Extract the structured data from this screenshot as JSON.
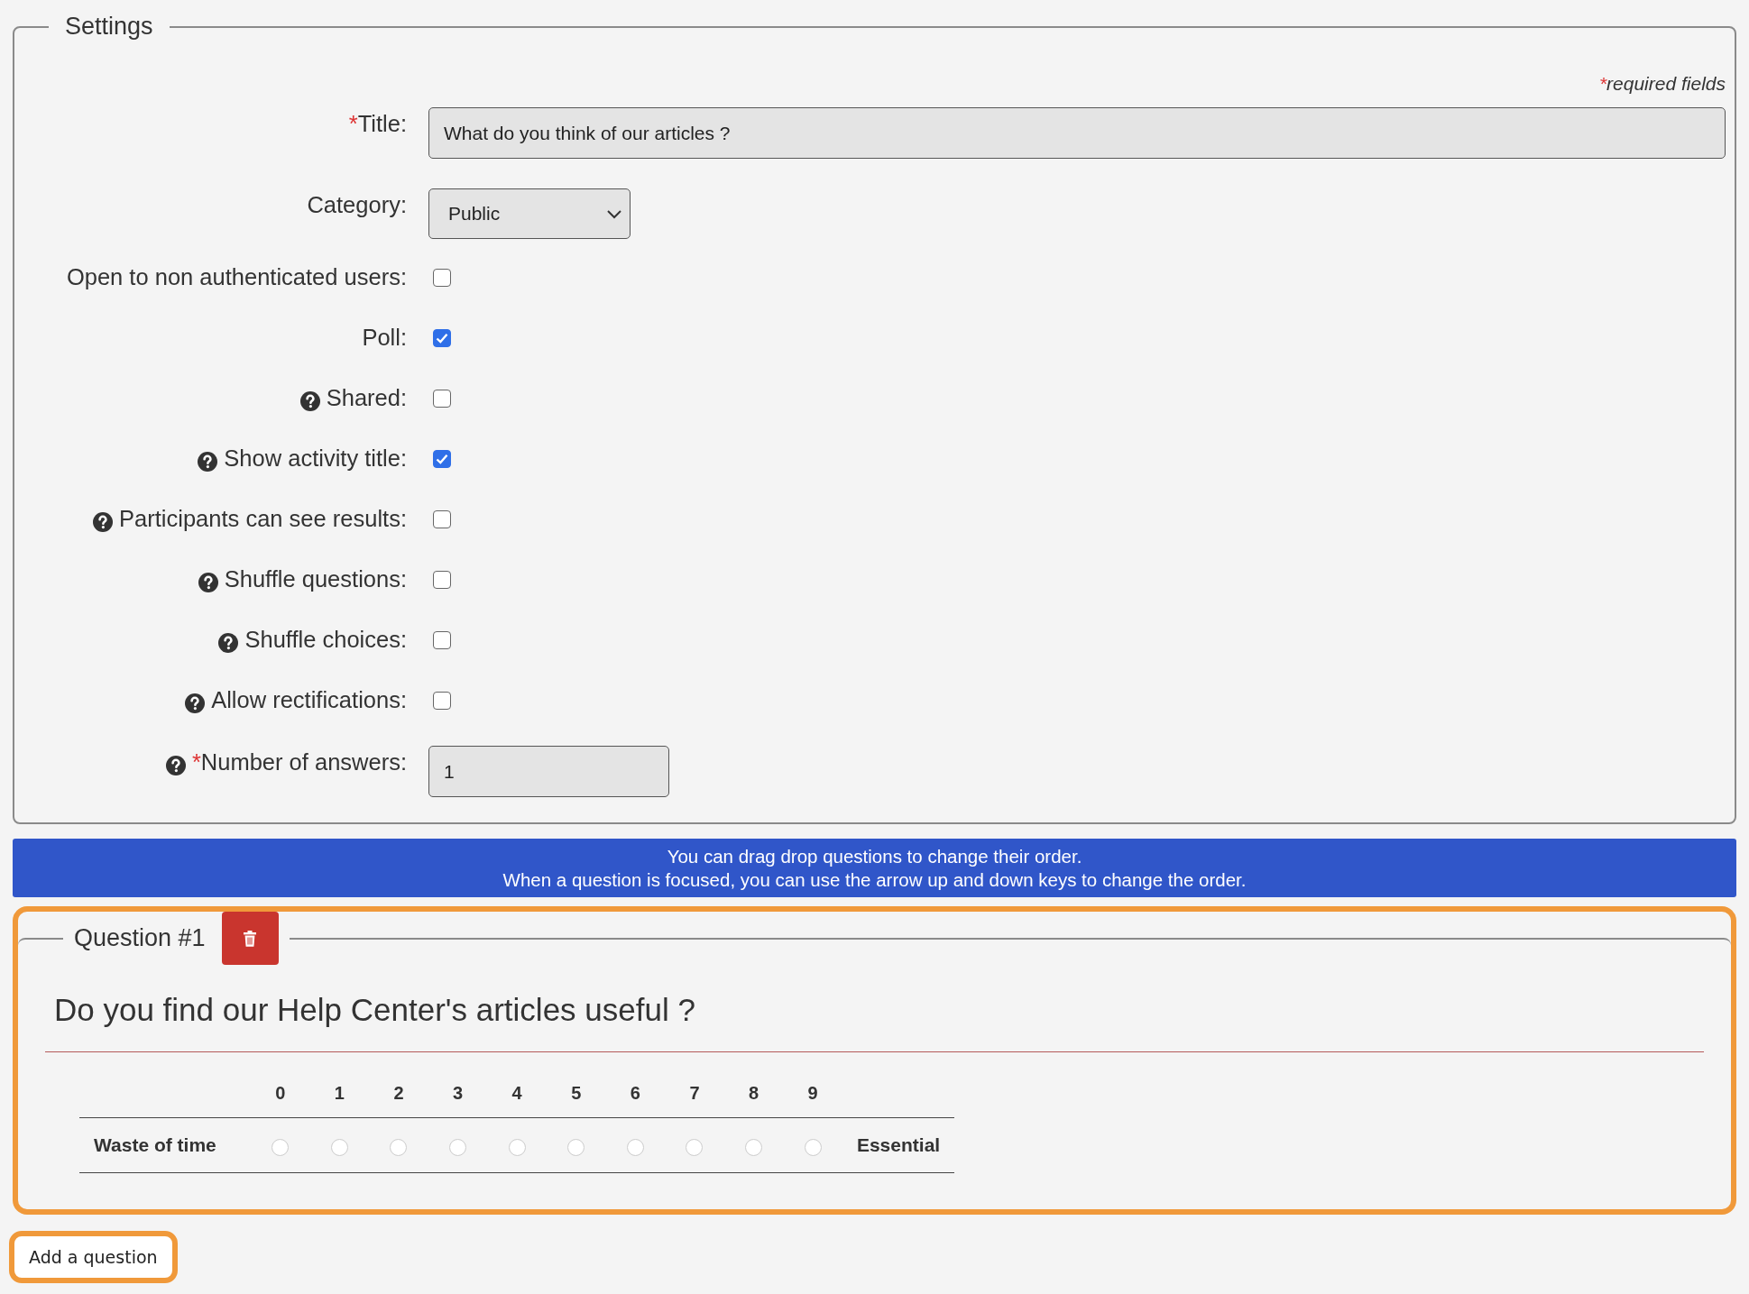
{
  "settings": {
    "legend": "Settings",
    "required_note": {
      "mark": "*",
      "text": "required fields"
    },
    "rows": [
      {
        "kind": "text",
        "label": "Title:",
        "required": true,
        "help": false,
        "value": "What do you think of our articles ?"
      },
      {
        "kind": "select",
        "label": "Category:",
        "required": false,
        "help": false,
        "value": "Public"
      },
      {
        "kind": "checkbox",
        "label": "Open to non authenticated users:",
        "required": false,
        "help": false,
        "checked": false
      },
      {
        "kind": "checkbox",
        "label": "Poll:",
        "required": false,
        "help": false,
        "checked": true
      },
      {
        "kind": "checkbox",
        "label": "Shared:",
        "required": false,
        "help": true,
        "checked": false
      },
      {
        "kind": "checkbox",
        "label": "Show activity title:",
        "required": false,
        "help": true,
        "checked": true
      },
      {
        "kind": "checkbox",
        "label": "Participants can see results:",
        "required": false,
        "help": true,
        "checked": false
      },
      {
        "kind": "checkbox",
        "label": "Shuffle questions:",
        "required": false,
        "help": true,
        "checked": false
      },
      {
        "kind": "checkbox",
        "label": "Shuffle choices:",
        "required": false,
        "help": true,
        "checked": false
      },
      {
        "kind": "checkbox",
        "label": "Allow rectifications:",
        "required": false,
        "help": true,
        "checked": false
      },
      {
        "kind": "number",
        "label": "Number of answers:",
        "required": true,
        "help": true,
        "value": "1"
      }
    ]
  },
  "info_banner": [
    "You can drag drop questions to change their order.",
    "When a question is focused, you can use the arrow up and down keys to change the order."
  ],
  "questions": [
    {
      "legend": "Question #1",
      "focused": true,
      "text": "Do you find our Help Center's articles useful ?",
      "scale": {
        "values": [
          "0",
          "1",
          "2",
          "3",
          "4",
          "5",
          "6",
          "7",
          "8",
          "9"
        ],
        "low_label": "Waste of time",
        "high_label": "Essential",
        "options": [
          {
            "selected": false
          },
          {
            "selected": false
          },
          {
            "selected": false
          },
          {
            "selected": false
          },
          {
            "selected": false
          },
          {
            "selected": false
          },
          {
            "selected": false
          },
          {
            "selected": false
          },
          {
            "selected": false
          },
          {
            "selected": false
          }
        ]
      }
    }
  ],
  "add_button": {
    "label": "Add a question",
    "focused": true
  }
}
